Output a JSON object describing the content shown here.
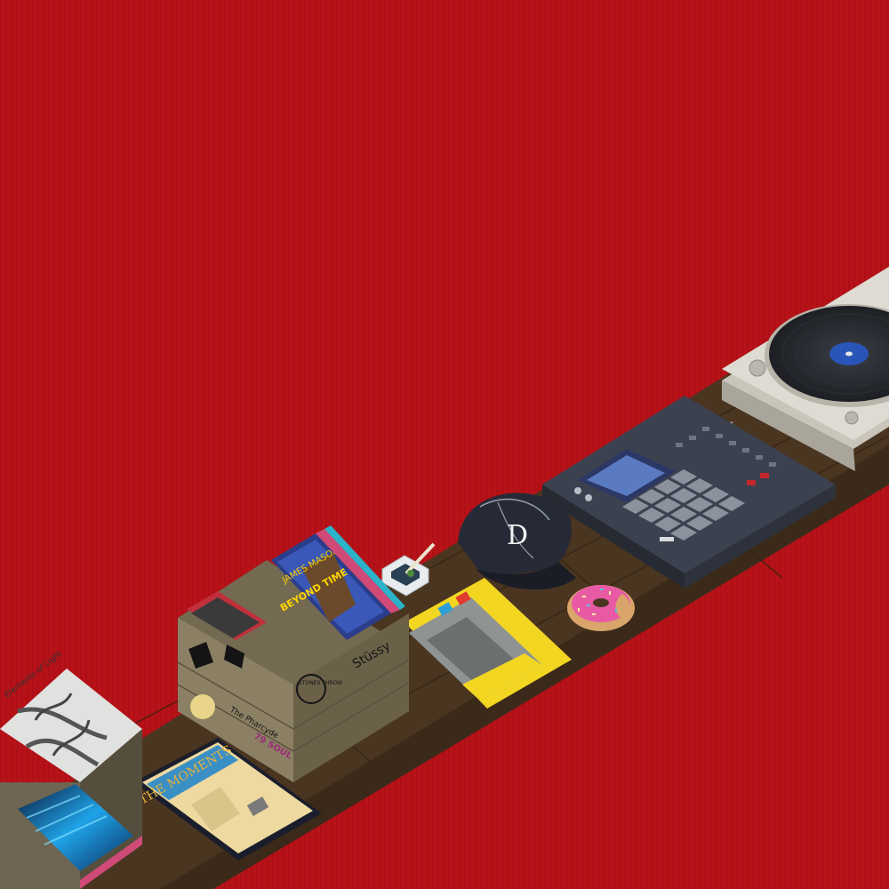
{
  "scene": {
    "background_color": "#b71218",
    "floor_color": "#4a3521",
    "accent_yellow": "#f2d622",
    "turntable_color": "#dedbd2",
    "sampler_color": "#3c4150",
    "donut_frosting": "#e95aa5"
  },
  "labels": {
    "crate_record_title": "JAMES MASON",
    "crate_record_subtitle": "BEYOND TIME",
    "crate_sticker_brand": "Stüssy",
    "crate_sticker_label": "The Pharcyde",
    "crate_sticker_stones": "STONES THROW",
    "crate_sticker_soul": "79 SOUL",
    "floor_record_title": "THE MOMENTS",
    "stack_record_title": "Elements of Light",
    "cap_logo": "D"
  },
  "icons": {
    "turntable": "turntable-icon",
    "sampler": "drum-machine-icon",
    "cap": "baseball-cap-icon",
    "donut": "donut-icon",
    "ashtray": "ashtray-icon",
    "crate": "record-crate-icon"
  }
}
